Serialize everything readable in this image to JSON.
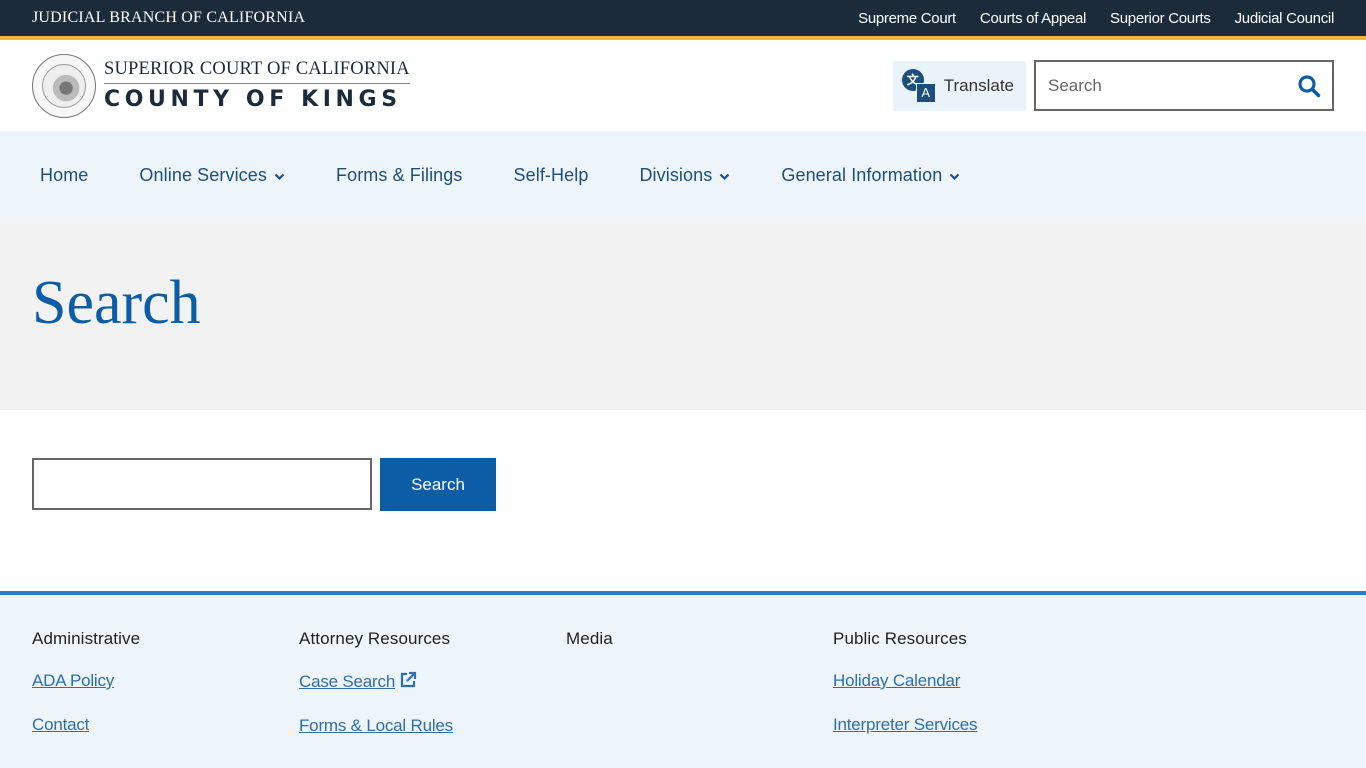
{
  "utility_bar": {
    "brand": "JUDICIAL BRANCH OF CALIFORNIA",
    "links": [
      {
        "label": "Supreme Court"
      },
      {
        "label": "Courts of Appeal"
      },
      {
        "label": "Superior Courts"
      },
      {
        "label": "Judicial Council"
      }
    ]
  },
  "header": {
    "logo": {
      "seal_icon": "judicial-branch-seal",
      "line1": "SUPERIOR COURT OF CALIFORNIA",
      "line2": "COUNTY OF KINGS"
    },
    "translate": {
      "icon": "translate-icon",
      "label": "Translate",
      "glyph_source": "文",
      "glyph_target": "A"
    },
    "search": {
      "placeholder": "Search",
      "value": "",
      "icon": "search-icon"
    }
  },
  "nav": {
    "items": [
      {
        "label": "Home",
        "has_dropdown": false
      },
      {
        "label": "Online Services",
        "has_dropdown": true
      },
      {
        "label": "Forms & Filings",
        "has_dropdown": false
      },
      {
        "label": "Self-Help",
        "has_dropdown": false
      },
      {
        "label": "Divisions",
        "has_dropdown": true
      },
      {
        "label": "General Information",
        "has_dropdown": true
      }
    ]
  },
  "page": {
    "title": "Search",
    "search_input_value": "",
    "search_button_label": "Search"
  },
  "footer": {
    "columns": [
      {
        "heading": "Administrative",
        "links": [
          {
            "label": "ADA Policy"
          },
          {
            "label": "Contact"
          }
        ]
      },
      {
        "heading": "Attorney Resources",
        "links": [
          {
            "label": "Case Search",
            "external": true
          },
          {
            "label": "Forms & Local Rules"
          }
        ]
      },
      {
        "heading": "Media",
        "links": []
      },
      {
        "heading": "Public Resources",
        "links": [
          {
            "label": "Holiday Calendar"
          },
          {
            "label": "Interpreter Services"
          }
        ]
      }
    ]
  },
  "colors": {
    "utility_bg": "#1c2b3a",
    "accent_gold": "#f0b83b",
    "primary_blue": "#0c5da5",
    "nav_bg": "#edf4fa",
    "nav_text": "#1d4e7c",
    "hero_bg": "#f2f2f2",
    "footer_border": "#2f7bbf",
    "link": "#2f6ea8"
  }
}
